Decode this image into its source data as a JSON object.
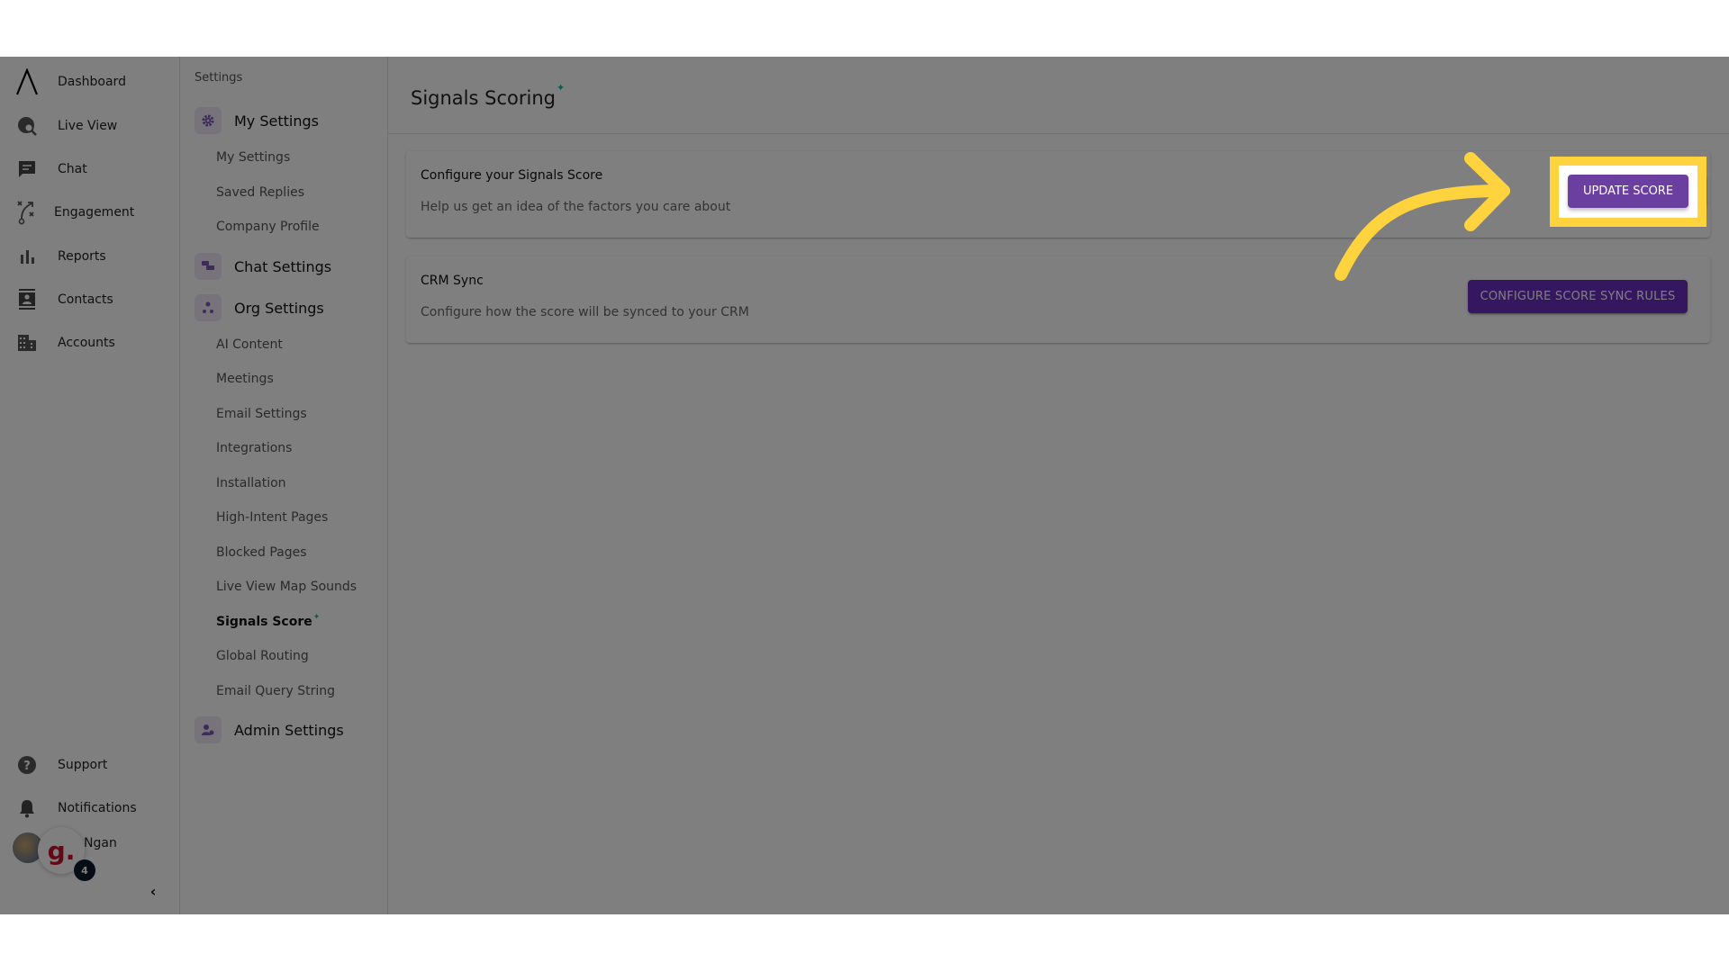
{
  "nav": {
    "items": [
      {
        "label": "Dashboard",
        "icon": "logo-icon"
      },
      {
        "label": "Live View",
        "icon": "globe-search-icon"
      },
      {
        "label": "Chat",
        "icon": "chat-icon"
      },
      {
        "label": "Engagement",
        "icon": "strategy-icon"
      },
      {
        "label": "Reports",
        "icon": "bar-chart-icon"
      },
      {
        "label": "Contacts",
        "icon": "contact-card-icon"
      },
      {
        "label": "Accounts",
        "icon": "building-icon"
      }
    ],
    "bottom": [
      {
        "label": "Support",
        "icon": "help-icon"
      },
      {
        "label": "Notifications",
        "icon": "bell-icon"
      }
    ],
    "user": {
      "name": "Ngan",
      "badge_letter": "g.",
      "notification_count": "4"
    },
    "collapse_icon": "‹"
  },
  "settings": {
    "title": "Settings",
    "groups": {
      "my_settings": {
        "label": "My Settings",
        "items": [
          "My Settings",
          "Saved Replies",
          "Company Profile"
        ]
      },
      "chat_settings": {
        "label": "Chat Settings"
      },
      "org_settings": {
        "label": "Org Settings",
        "items": [
          "AI Content",
          "Meetings",
          "Email Settings",
          "Integrations",
          "Installation",
          "High-Intent Pages",
          "Blocked Pages",
          "Live View Map Sounds",
          "Signals Score",
          "Global Routing",
          "Email Query String"
        ]
      },
      "admin_settings": {
        "label": "Admin Settings"
      }
    },
    "active_item": "Signals Score",
    "sparkle": "✦"
  },
  "main": {
    "title": "Signals Scoring",
    "sparkle": "✦",
    "cards": [
      {
        "title": "Configure your Signals Score",
        "description": "Help us get an idea of the factors you care about",
        "button": "UPDATE SCORE"
      },
      {
        "title": "CRM Sync",
        "description": "Configure how the score will be synced to your CRM",
        "button": "CONFIGURE SCORE SYNC RULES"
      }
    ]
  },
  "annotation": {
    "highlight_color": "#FFD33D",
    "target": "UPDATE SCORE"
  }
}
